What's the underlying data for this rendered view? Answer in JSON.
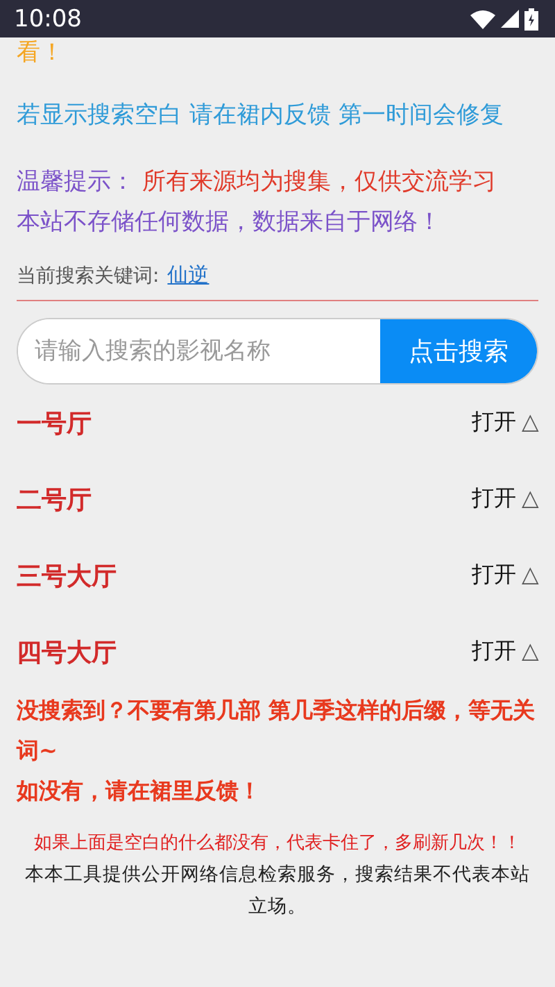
{
  "status_bar": {
    "time": "10:08"
  },
  "notice_top": "看！",
  "notice_blank": "若显示搜索空白 请在裙内反馈 第一时间会修复",
  "tip": {
    "label": "温馨提示：",
    "text": "所有来源均为搜集，仅供交流学习",
    "line2": "本站不存储任何数据，数据来自于网络！"
  },
  "keyword": {
    "label": "当前搜索关键词:",
    "value": "仙逆"
  },
  "search": {
    "placeholder": "请输入搜索的影视名称",
    "button": "点击搜索"
  },
  "halls": [
    {
      "name": "一号厅",
      "action": "打开",
      "arrow": "△"
    },
    {
      "name": "二号厅",
      "action": "打开",
      "arrow": "△"
    },
    {
      "name": "三号大厅",
      "action": "打开",
      "arrow": "△"
    },
    {
      "name": "四号大厅",
      "action": "打开",
      "arrow": "△"
    }
  ],
  "warning": [
    "没搜索到？不要有第几部 第几季这样的后缀，等无关词~",
    "如没有，请在裙里反馈！"
  ],
  "refresh_note": "如果上面是空白的什么都没有，代表卡住了，多刷新几次！！",
  "disclaimer": "本本工具提供公开网络信息检索服务，搜索结果不代表本站立场。"
}
